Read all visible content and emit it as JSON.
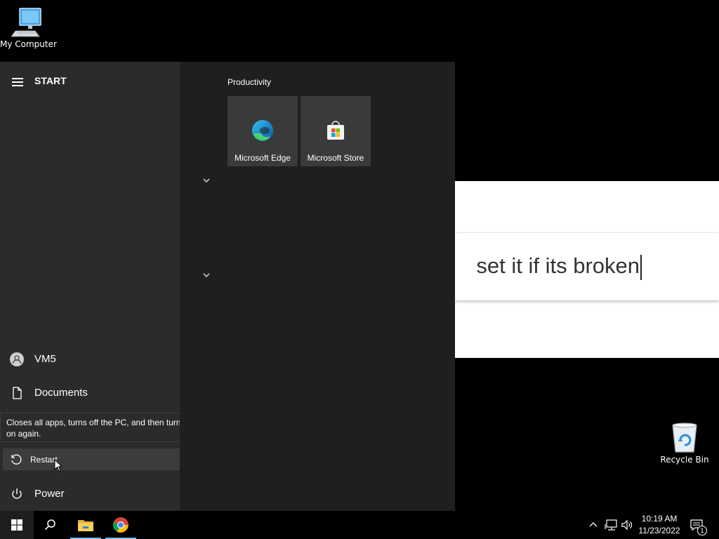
{
  "desktop": {
    "icons": [
      {
        "label": "My Computer",
        "icon": "computer-icon"
      },
      {
        "label": "Recycle Bin",
        "icon": "recycle-bin-icon"
      }
    ]
  },
  "background_window": {
    "search_text": "set it if its broken"
  },
  "start_menu": {
    "title": "START",
    "nav": {
      "user": "VM5",
      "documents": "Documents",
      "restart": "Restart",
      "power": "Power"
    },
    "tooltip": "Closes all apps, turns off the PC, and then turns it on again.",
    "group_label": "Productivity",
    "tiles": [
      {
        "label": "Microsoft Edge",
        "icon": "edge-icon"
      },
      {
        "label": "Microsoft Store",
        "icon": "store-icon"
      }
    ]
  },
  "taskbar": {
    "items": [
      "start-icon",
      "search-icon",
      "file-explorer-icon",
      "chrome-icon"
    ],
    "time": "10:19 AM",
    "date": "11/23/2022",
    "notification_count": "1"
  },
  "colors": {
    "accent": "#76b9ed",
    "start_left_bg": "#2b2b2b",
    "start_right_bg": "#1f1f1f",
    "tile_bg": "#3a3a3a"
  }
}
